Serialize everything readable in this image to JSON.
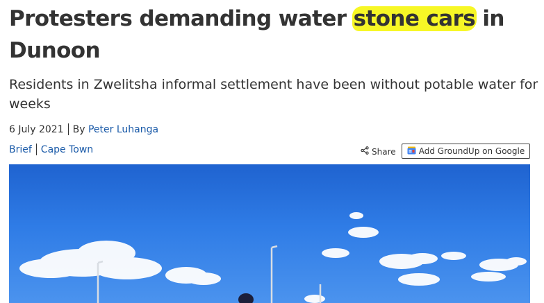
{
  "article": {
    "title_before": "Protesters demanding water ",
    "title_highlight": "stone cars",
    "title_after": " in Dunoon",
    "subtitle": "Residents in Zwelitsha informal settlement have been without potable water for weeks",
    "date": "6 July 2021",
    "by_label": "By",
    "author": "Peter Luhanga",
    "tags": [
      "Brief",
      "Cape Town"
    ]
  },
  "actions": {
    "share_label": "Share",
    "share_icon": "share-icon",
    "google_label": "Add GroundUp on Google",
    "google_icon": "google-news-icon"
  },
  "colors": {
    "highlight": "#f7f726",
    "link": "#1a5aa8",
    "sky": "#2f7ce6"
  }
}
